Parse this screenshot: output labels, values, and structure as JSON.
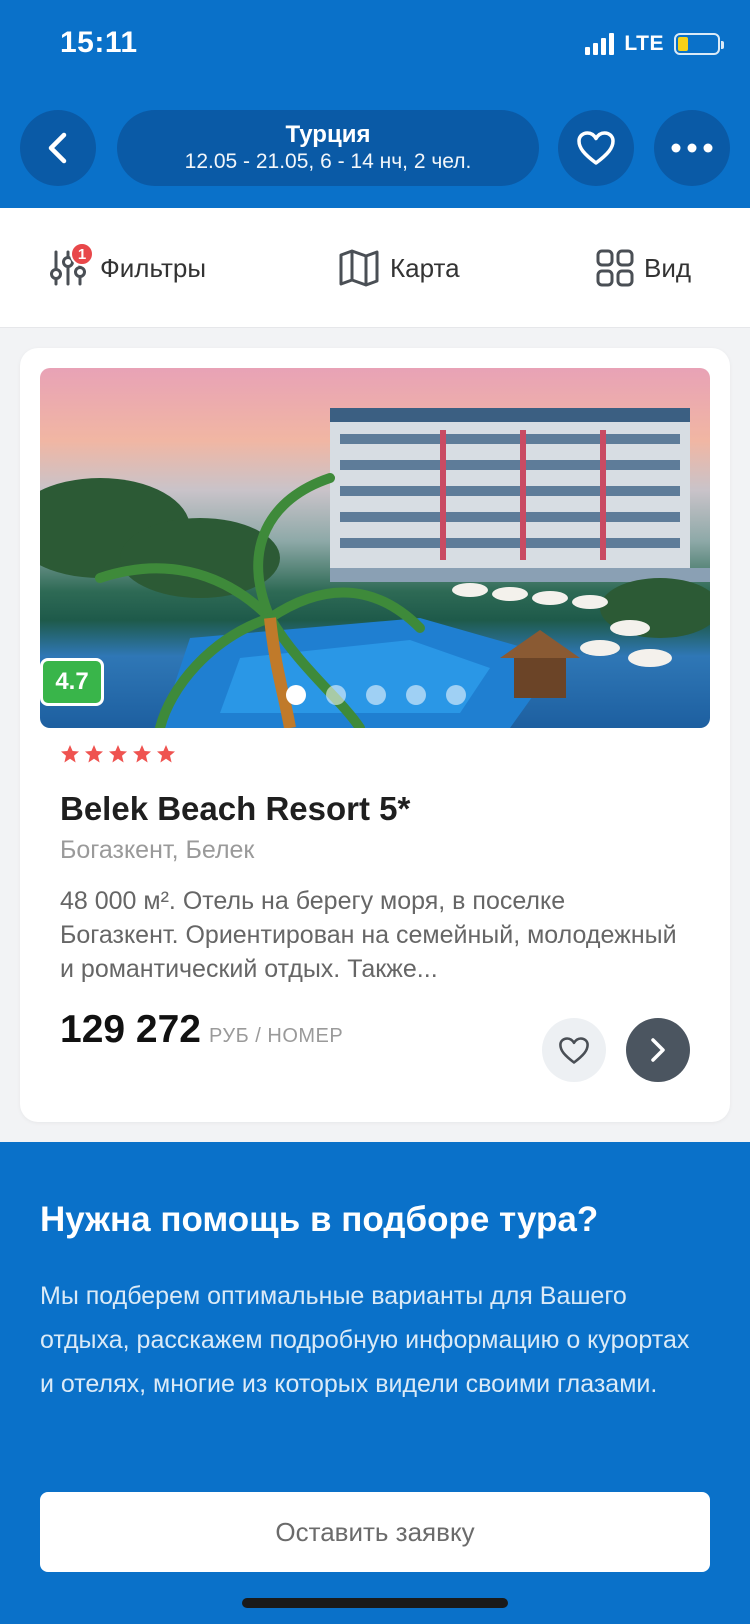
{
  "status": {
    "time": "15:11",
    "network": "LTE"
  },
  "header": {
    "destination": "Турция",
    "details": "12.05 - 21.05, 6 - 14 нч, 2 чел."
  },
  "toolbar": {
    "filters_label": "Фильтры",
    "filters_badge": "1",
    "map_label": "Карта",
    "view_label": "Вид"
  },
  "hotel": {
    "rating": "4.7",
    "stars": 5,
    "name": "Belek Beach Resort 5*",
    "location": "Богазкент, Белек",
    "description": "48 000 м². Отель на берегу моря, в поселке Богазкент. Ориентирован на семейный, молодежный и романтический отдых. Также...",
    "price": "129 272",
    "price_unit": "РУБ / НОМЕР",
    "photo_count": 5,
    "photo_active_index": 0
  },
  "help": {
    "title": "Нужна помощь в подборе тура?",
    "text": "Мы подберем оптимальные варианты для Вашего отдыха, расскажем подробную информацию о курортах и отелях, многие из которых видели своими глазами.",
    "button_label": "Оставить заявку"
  },
  "colors": {
    "brand_blue": "#0a71c9",
    "dark_blue": "#0a5aa6",
    "rating_green": "#39b54a",
    "star_red": "#ef5350",
    "badge_red": "#e8474a"
  },
  "icons": {
    "back": "chevron-left-icon",
    "favorite": "heart-icon",
    "more": "more-dots-icon",
    "filters": "sliders-icon",
    "map": "map-icon",
    "view": "grid-icon",
    "next": "chevron-right-icon",
    "star": "star-icon"
  }
}
